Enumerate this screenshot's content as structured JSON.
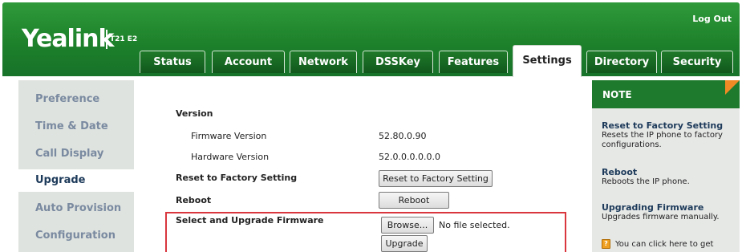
{
  "header": {
    "logo": "Yealink",
    "model": "T21 E2",
    "logout": "Log Out"
  },
  "tabs": [
    {
      "label": "Status"
    },
    {
      "label": "Account"
    },
    {
      "label": "Network"
    },
    {
      "label": "DSSKey"
    },
    {
      "label": "Features"
    },
    {
      "label": "Settings",
      "active": true
    },
    {
      "label": "Directory"
    },
    {
      "label": "Security"
    }
  ],
  "sidebar": {
    "items": [
      {
        "label": "Preference"
      },
      {
        "label": "Time & Date"
      },
      {
        "label": "Call Display"
      },
      {
        "label": "Upgrade",
        "active": true
      },
      {
        "label": "Auto Provision"
      },
      {
        "label": "Configuration"
      }
    ]
  },
  "main": {
    "version_heading": "Version",
    "firmware_label": "Firmware Version",
    "firmware_value": "52.80.0.90",
    "hardware_label": "Hardware Version",
    "hardware_value": "52.0.0.0.0.0.0",
    "reset_label": "Reset to Factory Setting",
    "reset_button": "Reset to Factory Setting",
    "reboot_label": "Reboot",
    "reboot_button": "Reboot",
    "upgrade_label": "Select and Upgrade Firmware",
    "browse_button": "Browse...",
    "file_status": "No file selected.",
    "upgrade_button": "Upgrade"
  },
  "note": {
    "heading": "NOTE",
    "items": [
      {
        "title": "Reset to Factory Setting",
        "text": "Resets the IP phone to factory configurations."
      },
      {
        "title": "Reboot",
        "text": "Reboots the IP phone."
      },
      {
        "title": "Upgrading Firmware",
        "text": "Upgrades firmware manually."
      }
    ],
    "help_text": "You can click here to get"
  },
  "colors": {
    "header_green": "#1c7f2a",
    "note_corner": "#f08a24",
    "highlight_box": "#d9363e"
  }
}
